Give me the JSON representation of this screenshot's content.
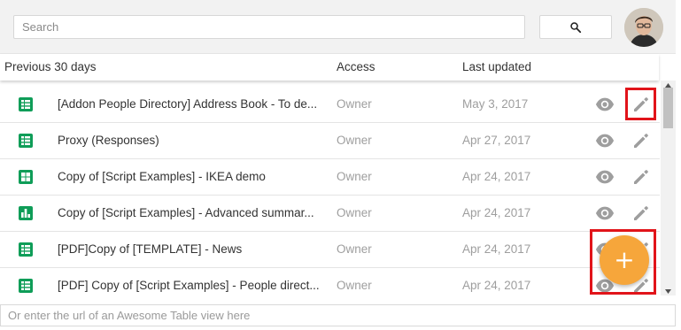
{
  "search": {
    "placeholder": "Search"
  },
  "header": {
    "name_label": "Previous 30 days",
    "access_label": "Access",
    "updated_label": "Last updated"
  },
  "colors": {
    "accent": "#0f9d58",
    "fab": "#f6a63b",
    "highlight": "#e1141a"
  },
  "rows": [
    {
      "name": "[Addon People Directory] Address Book - To de...",
      "access": "Owner",
      "updated": "May 3, 2017",
      "icon": "sheets-list-icon"
    },
    {
      "name": "Proxy (Responses)",
      "access": "Owner",
      "updated": "Apr 27, 2017",
      "icon": "sheets-list-icon"
    },
    {
      "name": "Copy of [Script Examples] - IKEA demo",
      "access": "Owner",
      "updated": "Apr 24, 2017",
      "icon": "grid-icon"
    },
    {
      "name": "Copy of [Script Examples] - Advanced summar...",
      "access": "Owner",
      "updated": "Apr 24, 2017",
      "icon": "bar-chart-icon"
    },
    {
      "name": "[PDF]Copy of [TEMPLATE] - News",
      "access": "Owner",
      "updated": "Apr 24, 2017",
      "icon": "sheets-list-icon"
    },
    {
      "name": "[PDF] Copy of [Script Examples] - People direct...",
      "access": "Owner",
      "updated": "Apr 24, 2017",
      "icon": "sheets-list-icon"
    }
  ],
  "fab": {
    "label": "+"
  },
  "url_input": {
    "placeholder": "Or enter the url of an Awesome Table view here"
  }
}
